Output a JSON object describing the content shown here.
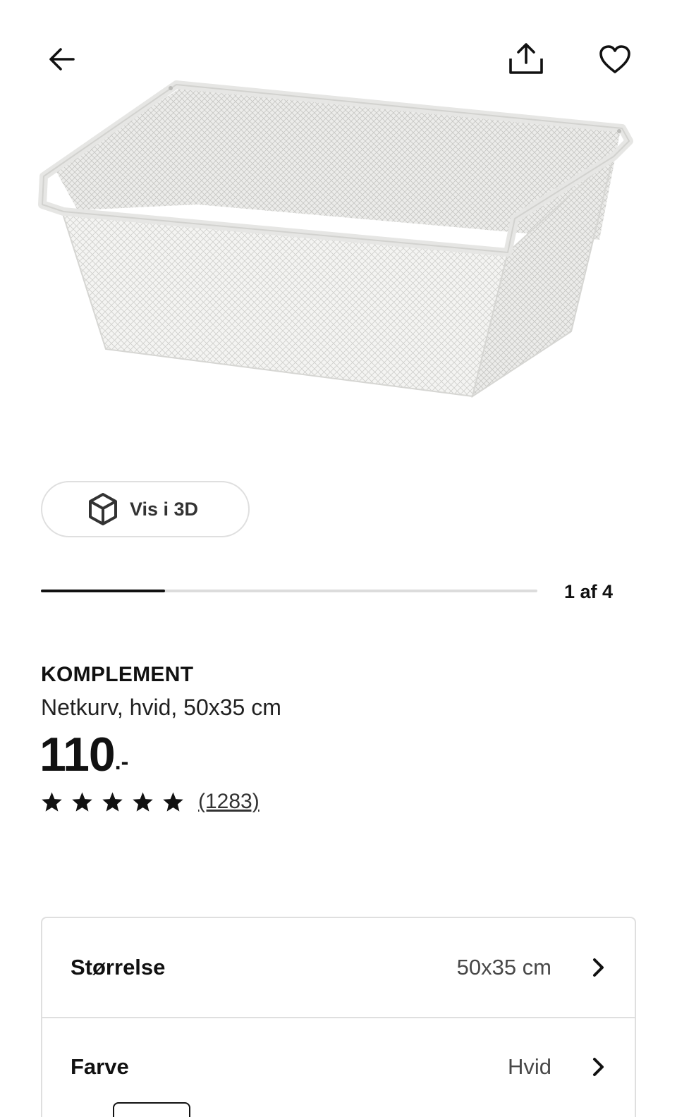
{
  "header": {
    "back_icon": "arrow-left-icon",
    "share_icon": "share-upload-icon",
    "favorite_icon": "heart-outline-icon"
  },
  "gallery": {
    "image_alt": "KOMPLEMENT Netkurv, hvid",
    "view_3d_label": "Vis i 3D",
    "view_3d_icon": "cube-3d-icon",
    "progress_fraction": 0.25,
    "counter_text": "1 af 4"
  },
  "product": {
    "name": "KOMPLEMENT",
    "description": "Netkurv, hvid, 50x35 cm",
    "price": "110",
    "price_suffix": ".-",
    "rating_stars": 5,
    "review_count": "(1283)"
  },
  "options": [
    {
      "label": "Størrelse",
      "value": "50x35 cm"
    },
    {
      "label": "Farve",
      "value": "Hvid"
    }
  ],
  "colors": {
    "text_primary": "#111111",
    "border": "#dfdfdf",
    "progress_track": "#dcdcdc"
  }
}
